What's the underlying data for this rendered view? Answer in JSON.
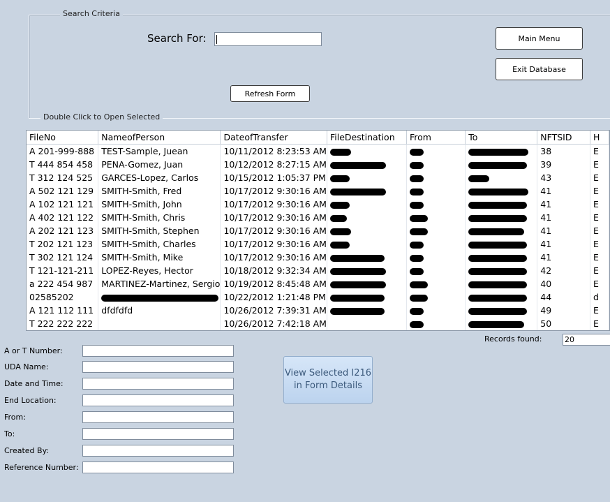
{
  "search_criteria": {
    "title": "Search Criteria",
    "search_label": "Search For:",
    "search_value": "",
    "refresh_button": "Refresh Form",
    "main_menu_button": "Main Menu",
    "exit_button": "Exit Database"
  },
  "grid": {
    "caption": "Double Click to Open Selected",
    "columns": [
      "FileNo",
      "NameofPerson",
      "DateofTransfer",
      "FileDestination",
      "From",
      "To",
      "NFTSID",
      "H"
    ],
    "rows": [
      [
        "A 201-999-888",
        "TEST-Sample, Juean",
        "10/11/2012 8:23:53 AM",
        "",
        "",
        "",
        "38",
        "E"
      ],
      [
        "T 444 854 458",
        "PENA-Gomez, Juan",
        "10/12/2012 8:27:15 AM",
        "",
        "",
        "",
        "39",
        "E"
      ],
      [
        "T 312 124 525",
        "GARCES-Lopez, Carlos",
        "10/15/2012 1:05:37 PM",
        "",
        "",
        "",
        "43",
        "E"
      ],
      [
        "A 502 121 129",
        "SMITH-Smith, Fred",
        "10/17/2012 9:30:16 AM",
        "",
        "",
        "",
        "41",
        "E"
      ],
      [
        "A 102 121 121",
        "SMITH-Smith, John",
        "10/17/2012 9:30:16 AM",
        "",
        "",
        "",
        "41",
        "E"
      ],
      [
        "A 402 121 122",
        "SMITH-Smith, Chris",
        "10/17/2012 9:30:16 AM",
        "",
        "",
        "",
        "41",
        "E"
      ],
      [
        "A 202 121 123",
        "SMITH-Smith, Stephen",
        "10/17/2012 9:30:16 AM",
        "",
        "",
        "",
        "41",
        "E"
      ],
      [
        "T 202 121 123",
        "SMITH-Smith, Charles",
        "10/17/2012 9:30:16 AM",
        "",
        "",
        "",
        "41",
        "E"
      ],
      [
        "T 302 121 124",
        "SMITH-Smith, Mike",
        "10/17/2012 9:30:16 AM",
        "",
        "",
        "",
        "41",
        "E"
      ],
      [
        "T 121-121-211",
        "LOPEZ-Reyes, Hector",
        "10/18/2012 9:32:34 AM",
        "",
        "",
        "",
        "42",
        "E"
      ],
      [
        "a 222 454 987",
        "MARTINEZ-Martinez, Sergio",
        "10/19/2012 8:45:48 AM",
        "",
        "",
        "",
        "40",
        "E"
      ],
      [
        "02585202",
        "",
        "10/22/2012 1:21:48 PM",
        "",
        "",
        "",
        "44",
        "d"
      ],
      [
        "A 121 112 111",
        "dfdfdfd",
        "10/26/2012 7:39:31 AM",
        "",
        "",
        "",
        "49",
        "E"
      ],
      [
        "T 222 222 222",
        "",
        "10/26/2012 7:42:18 AM",
        "",
        "",
        "",
        "50",
        "E"
      ]
    ]
  },
  "records": {
    "label": "Records found:",
    "count": "20"
  },
  "details": {
    "fields": [
      {
        "label": "A or T Number:",
        "value": ""
      },
      {
        "label": "UDA Name:",
        "value": ""
      },
      {
        "label": "Date and Time:",
        "value": ""
      },
      {
        "label": "End Location:",
        "value": ""
      },
      {
        "label": "From:",
        "value": ""
      },
      {
        "label": "To:",
        "value": ""
      },
      {
        "label": "Created By:",
        "value": ""
      },
      {
        "label": "Reference Number:",
        "value": ""
      }
    ],
    "view_button_line1": "View Selected I216",
    "view_button_line2": "in Form Details"
  }
}
